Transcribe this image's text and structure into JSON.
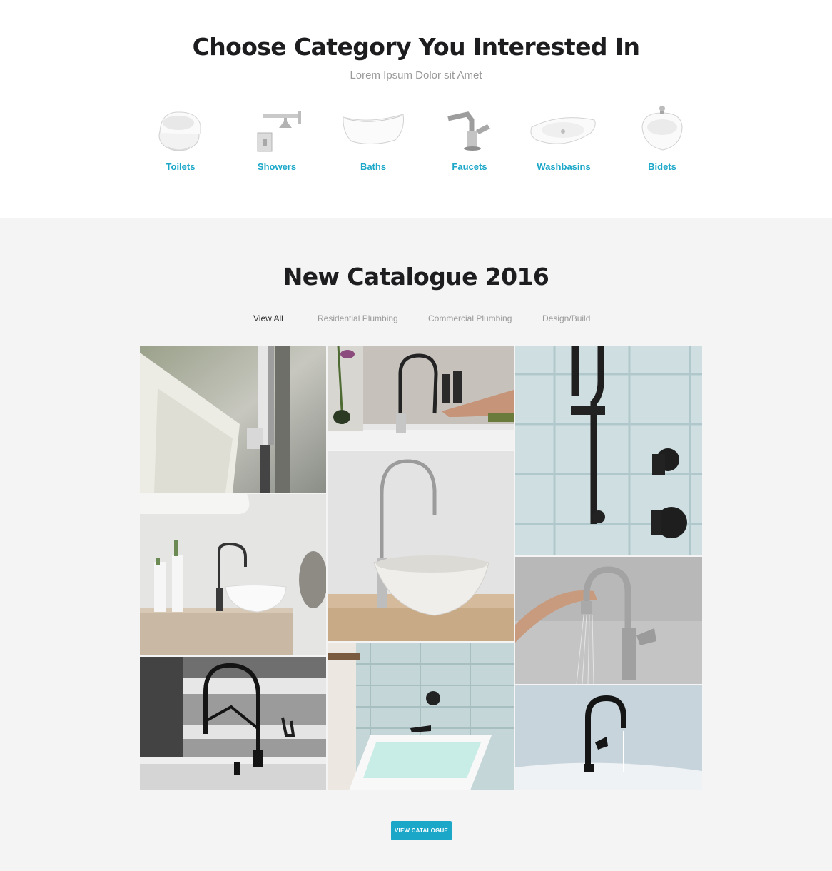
{
  "categories_section": {
    "title": "Choose Category You Interested In",
    "subtitle": "Lorem Ipsum Dolor sit Amet",
    "items": [
      {
        "label": "Toilets",
        "icon": "toilet-icon"
      },
      {
        "label": "Showers",
        "icon": "shower-icon"
      },
      {
        "label": "Baths",
        "icon": "bathtub-icon"
      },
      {
        "label": "Faucets",
        "icon": "faucet-icon"
      },
      {
        "label": "Washbasins",
        "icon": "washbasin-icon"
      },
      {
        "label": "Bidets",
        "icon": "bidet-icon"
      }
    ],
    "accent_color": "#1ba7c8"
  },
  "catalogue_section": {
    "title": "New Catalogue 2016",
    "filters": [
      {
        "label": "View All",
        "active": true
      },
      {
        "label": "Residential Plumbing",
        "active": false
      },
      {
        "label": "Commercial Plumbing",
        "active": false
      },
      {
        "label": "Design/Build",
        "active": false
      }
    ],
    "gallery": [
      {
        "subject": "chrome floor-mounted tub faucet"
      },
      {
        "subject": "pull-down kitchen faucet"
      },
      {
        "subject": "black shower slide bar"
      },
      {
        "subject": "gooseneck faucet with vessel sink"
      },
      {
        "subject": "tall faucet over conical basin"
      },
      {
        "subject": "stainless touch kitchen faucet"
      },
      {
        "subject": "black spring kitchen faucet"
      },
      {
        "subject": "wall-mounted tub spout"
      },
      {
        "subject": "black bar faucet"
      }
    ],
    "button_label": "VIEW CATALOGUE",
    "background_color": "#f4f4f4"
  }
}
